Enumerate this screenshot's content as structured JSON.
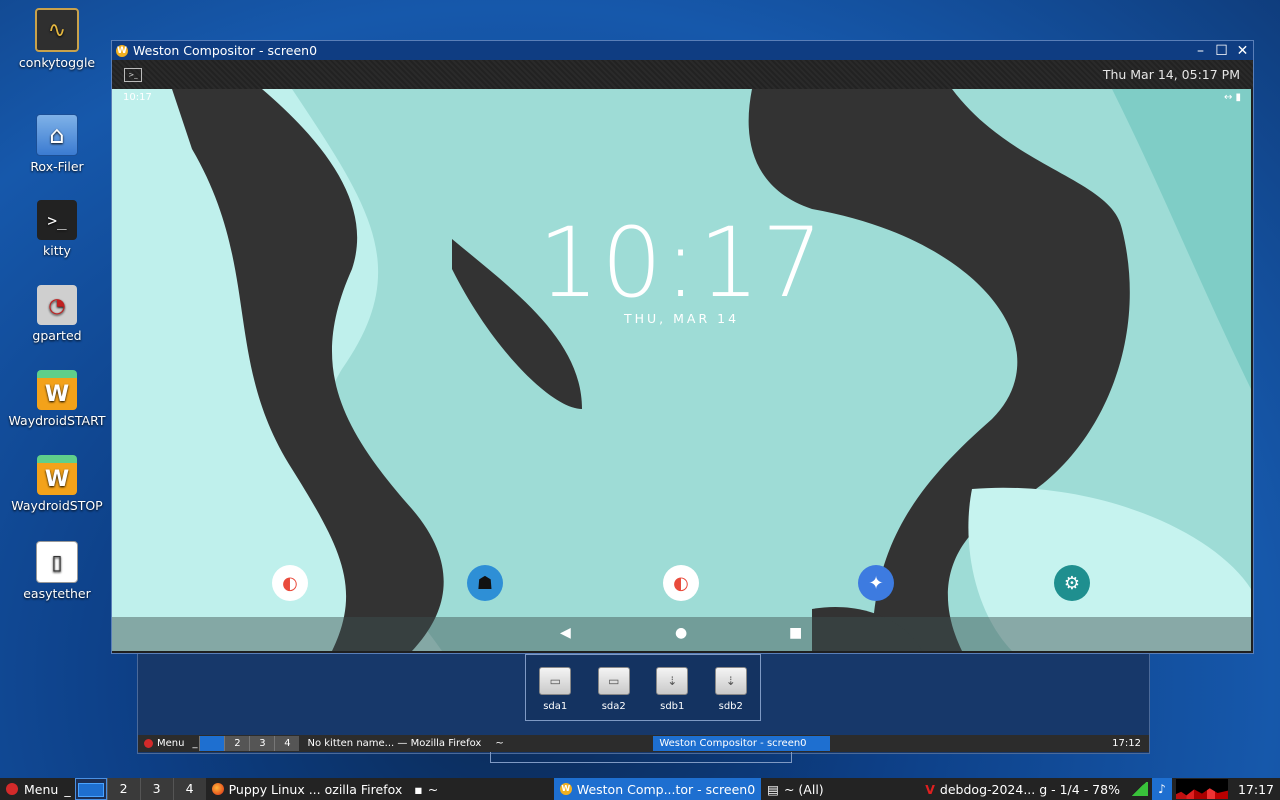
{
  "desktop": {
    "icons": [
      {
        "label": "conkytoggle"
      },
      {
        "label": "Rox-Filer"
      },
      {
        "label": "kitty"
      },
      {
        "label": "gparted"
      },
      {
        "label": "WaydroidSTART"
      },
      {
        "label": "WaydroidSTOP"
      },
      {
        "label": "easytether"
      }
    ]
  },
  "weston": {
    "title": "Weston Compositor - screen0",
    "topbar_datetime": "Thu Mar 14, 05:17 PM",
    "android": {
      "status_time": "10:17",
      "status_icons": "↔ ▮",
      "clock": "10:17",
      "date": "THU, MAR 14",
      "apps": [
        "dup-icon",
        "reader-icon",
        "dup-icon",
        "navigation-icon",
        "settings-icon"
      ],
      "nav": {
        "back": "◀",
        "home": "●",
        "recents": "■"
      }
    }
  },
  "drives": [
    "sda1",
    "sda2",
    "sdb1",
    "sdb2"
  ],
  "back_taskbar": {
    "menu": "Menu",
    "dash": "_",
    "pages": [
      "2",
      "3",
      "4"
    ],
    "task1": "No kitten name... — Mozilla Firefox",
    "task2": "~",
    "task3": "Weston Compositor - screen0",
    "clock": "17:12"
  },
  "taskbar": {
    "menu": "Menu",
    "dash": "_",
    "pages": [
      "2",
      "3",
      "4"
    ],
    "tasks": [
      {
        "label": "Puppy Linux ... ozilla Firefox"
      },
      {
        "label": "~"
      },
      {
        "label": "Weston Comp...tor - screen0"
      },
      {
        "label": "~ (All)"
      },
      {
        "label": "debdog-2024... g - 1/4 - 78%"
      }
    ],
    "clock": "17:17"
  },
  "colors": {
    "accent": "#1e6fd0",
    "android_teal": "#8fd8d2",
    "android_dark": "#333333"
  }
}
